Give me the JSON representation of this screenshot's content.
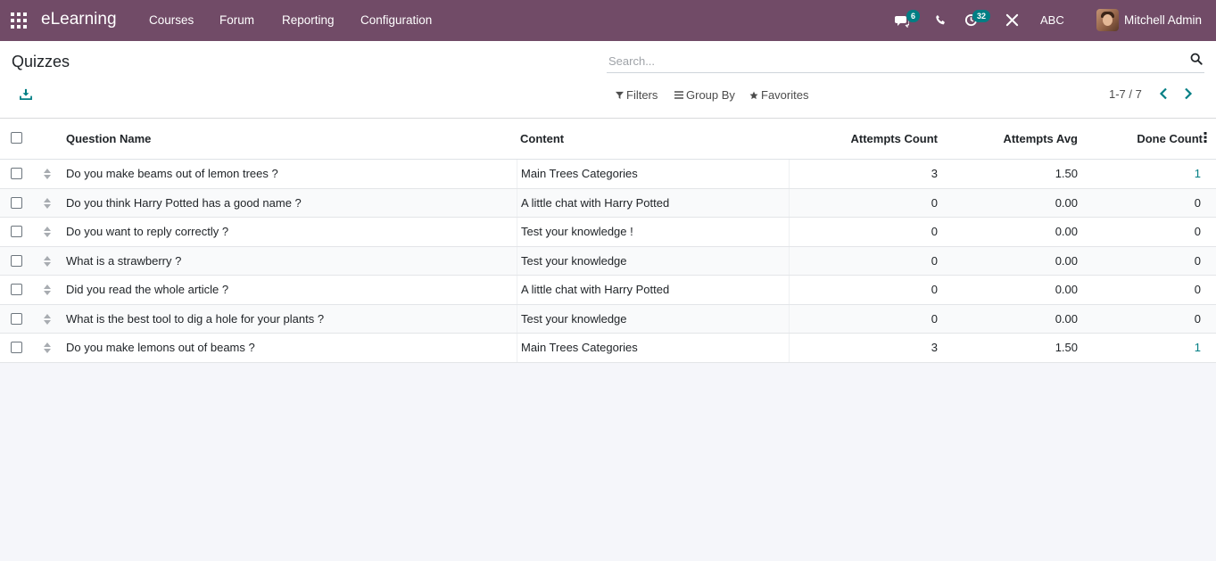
{
  "navbar": {
    "app_name": "eLearning",
    "menu": [
      "Courses",
      "Forum",
      "Reporting",
      "Configuration"
    ],
    "messages_badge": "6",
    "activities_badge": "32",
    "company": "ABC",
    "user": "Mitchell Admin",
    "accent_color": "#714b67",
    "badge_color": "#017e84"
  },
  "control_panel": {
    "title": "Quizzes",
    "search_placeholder": "Search...",
    "filters_label": "Filters",
    "group_by_label": "Group By",
    "favorites_label": "Favorites",
    "pager": "1-7 / 7"
  },
  "table": {
    "headers": {
      "question_name": "Question Name",
      "content": "Content",
      "attempts_count": "Attempts Count",
      "attempts_avg": "Attempts Avg",
      "done_count": "Done Count"
    },
    "rows": [
      {
        "question": "Do you make beams out of lemon trees ?",
        "content": "Main Trees Categories",
        "attempts_count": "3",
        "attempts_avg": "1.50",
        "done_count": "1"
      },
      {
        "question": "Do you think Harry Potted has a good name ?",
        "content": "A little chat with Harry Potted",
        "attempts_count": "0",
        "attempts_avg": "0.00",
        "done_count": "0"
      },
      {
        "question": "Do you want to reply correctly ?",
        "content": "Test your knowledge !",
        "attempts_count": "0",
        "attempts_avg": "0.00",
        "done_count": "0"
      },
      {
        "question": "What is a strawberry ?",
        "content": "Test your knowledge",
        "attempts_count": "0",
        "attempts_avg": "0.00",
        "done_count": "0"
      },
      {
        "question": "Did you read the whole article ?",
        "content": "A little chat with Harry Potted",
        "attempts_count": "0",
        "attempts_avg": "0.00",
        "done_count": "0"
      },
      {
        "question": "What is the best tool to dig a hole for your plants ?",
        "content": "Test your knowledge",
        "attempts_count": "0",
        "attempts_avg": "0.00",
        "done_count": "0"
      },
      {
        "question": "Do you make lemons out of beams ?",
        "content": "Main Trees Categories",
        "attempts_count": "3",
        "attempts_avg": "1.50",
        "done_count": "1"
      }
    ]
  }
}
